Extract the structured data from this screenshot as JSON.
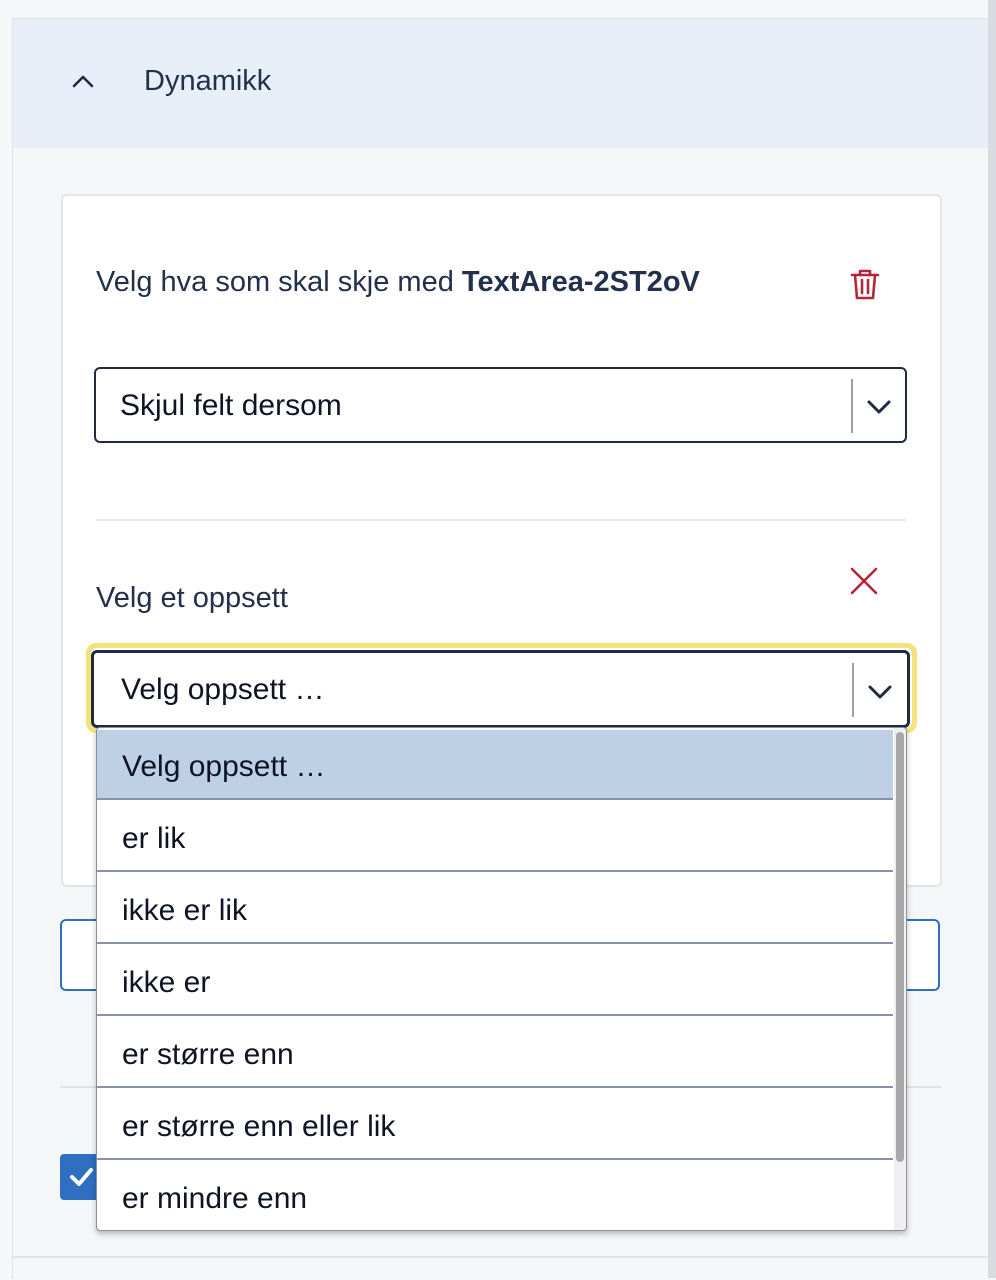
{
  "section": {
    "title": "Dynamikk"
  },
  "rule": {
    "prefix": "Velg hva som skal skje med ",
    "target": "TextArea-2ST2oV",
    "action_select_value": "Skjul felt dersom"
  },
  "condition": {
    "label": "Velg et oppsett",
    "select_value": "Velg oppsett …"
  },
  "dropdown": {
    "options": [
      "Velg oppsett …",
      "er lik",
      "ikke er lik",
      "ikke er",
      "er større enn",
      "er større enn eller lik",
      "er mindre enn"
    ],
    "selected_index": 0
  },
  "colors": {
    "header_bg": "#e7eef7",
    "danger": "#b3263a",
    "focus": "#f6e27a",
    "primary": "#2f6fc2",
    "option_highlight": "#bed0e6"
  },
  "icons": {
    "collapse": "chevron-up-icon",
    "delete": "trash-icon",
    "remove": "close-icon",
    "select_arrow": "chevron-down-icon"
  }
}
